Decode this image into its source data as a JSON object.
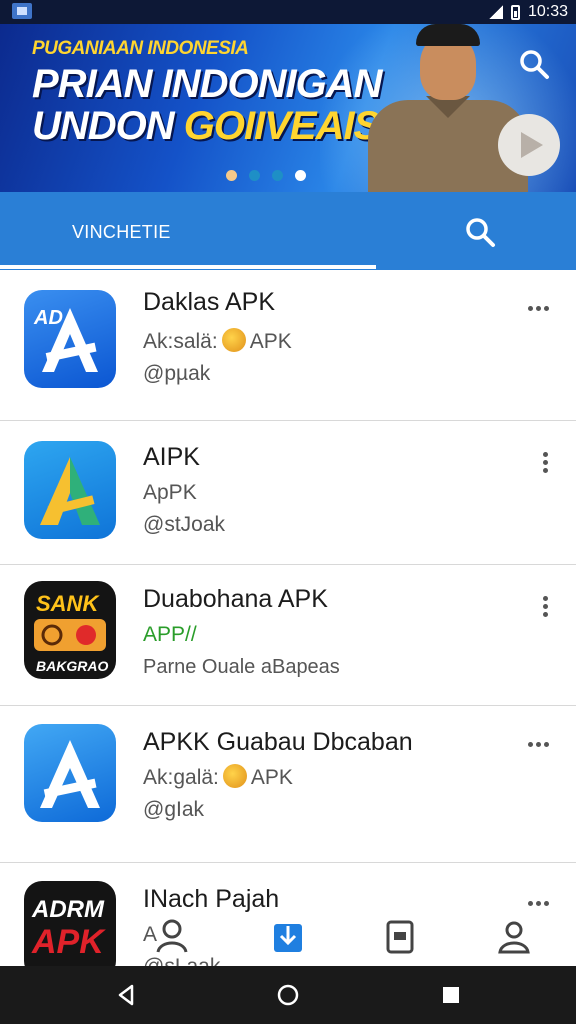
{
  "status_bar": {
    "time": "10:33"
  },
  "banner": {
    "kicker": "PUGANIAAN INDONESIA",
    "line1": "PRIAN INDONIGAN",
    "line2_a": "UNDON",
    "line2_b": "GOIIVEAIS",
    "carousel_dots": 4,
    "active_dot": 4
  },
  "tabs": {
    "active_label": "VINCHETIE"
  },
  "apps": [
    {
      "title": "Daklas APK",
      "subtitle": "Ak:salä:",
      "subtitle_suffix": "APK",
      "handle": "@pµak",
      "icon": "blue-a-icon",
      "icon_text": "AD",
      "more": "horizontal"
    },
    {
      "title": "AIPK",
      "subtitle": "ApPK",
      "handle": "@stJoak",
      "icon": "green-a-icon",
      "more": "vertical"
    },
    {
      "title": "Duabohana APK",
      "subtitle": "APP//",
      "handle": "Parne Ouale aBapeas",
      "icon": "sank-icon",
      "icon_text_top": "SANK",
      "icon_text_bottom": "BAKGRAO",
      "more": "vertical"
    },
    {
      "title": "APKK Guabau Dbcaban",
      "subtitle": "Ak:galä:",
      "subtitle_suffix": "APK",
      "handle": "@gIak",
      "icon": "blue-a-icon",
      "more": "horizontal"
    },
    {
      "title": "INach Pajah",
      "subtitle": "A",
      "handle": "@sLaak",
      "icon": "adrm-apk-icon",
      "icon_text_top": "ADRM",
      "icon_text_bottom": "APK",
      "more": "horizontal"
    }
  ],
  "bottom_nav": [
    "people-icon",
    "download-icon",
    "document-icon",
    "profile-icon"
  ],
  "colors": {
    "primary": "#2a7fd6",
    "banner": "#1452c8",
    "accent_yellow": "#ffd530",
    "green_text": "#2a9d2a"
  }
}
